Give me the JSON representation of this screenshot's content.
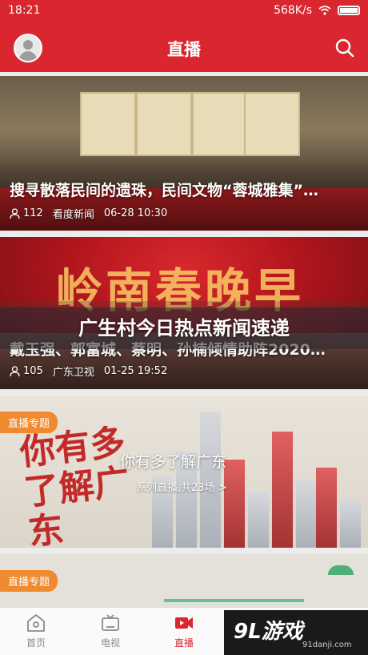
{
  "status": {
    "time": "18:21",
    "speed": "568K/s"
  },
  "header": {
    "title": "直播"
  },
  "cards": [
    {
      "title": "搜寻散落民间的遗珠，民间文物“蓉城雅集”…",
      "views": "112",
      "source": "看度新闻",
      "datetime": "06-28 10:30"
    },
    {
      "title": "戴玉强、郭富城、蔡明、孙楠倾情助阵2020…",
      "views": "105",
      "source": "广东卫视",
      "datetime": "01-25 19:52",
      "banner_text": "岭南春晚早"
    },
    {
      "tag": "直播专题",
      "title": "你有多了解广东",
      "subtitle": "系列直播,共23场 >",
      "calligraphy": "你有多了解广东"
    },
    {
      "tag": "直播专题"
    }
  ],
  "overlay": {
    "headline": "广生村今日热点新闻速递"
  },
  "tabs": [
    {
      "label": "首页",
      "icon": "home-icon"
    },
    {
      "label": "电视",
      "icon": "tv-icon"
    },
    {
      "label": "直播",
      "icon": "live-video-icon"
    }
  ],
  "watermark": {
    "logo": "9L游戏",
    "url": "91danji.com"
  },
  "colors": {
    "brand": "#d9262f",
    "tag": "#f08a2e"
  }
}
